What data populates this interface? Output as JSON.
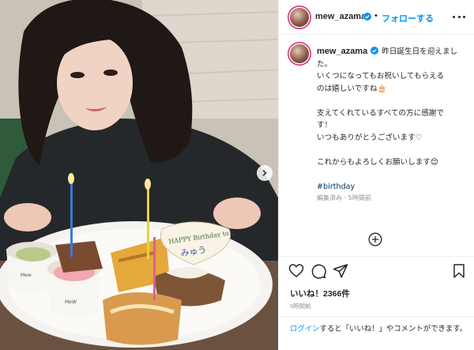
{
  "header": {
    "username": "mew_azama",
    "separator": "•",
    "follow_label": "フォローする"
  },
  "caption": {
    "username": "mew_azama",
    "first_line": "昨日誕生日を迎えまし",
    "lines": [
      "た。",
      "いくつになってもお祝いしてもらえる",
      "のは嬉しいですね🎂",
      "",
      "支えてくれているすべての方に感謝で",
      "す！",
      "いつもありがとうございます♡",
      "",
      "これからもよろしくお願いします😊",
      "",
      "#birthday"
    ],
    "meta": "編集済み · 5時間前"
  },
  "likes": {
    "prefix": "いいね！",
    "count": "2366件"
  },
  "post_time": "5時間前",
  "login": {
    "link": "ログイン",
    "rest": "すると「いいね！」やコメントができます。"
  },
  "photo": {
    "plate_label": "Mew",
    "cup_label": "MeW",
    "card_text_1": "HAPPY Birthday to…",
    "card_text_2": "みゅう"
  },
  "colors": {
    "accent": "#0095f6",
    "text": "#262626",
    "muted": "#8e8e8e",
    "hashtag": "#00376b"
  }
}
